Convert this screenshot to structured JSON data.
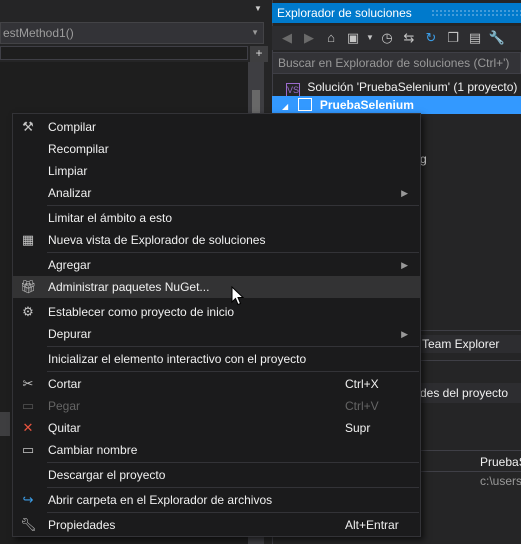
{
  "editor": {
    "method_dropdown": "estMethod1()",
    "split_button": "+"
  },
  "solution_explorer": {
    "title": "Explorador de soluciones",
    "search_placeholder": "Buscar en Explorador de soluciones (Ctrl+')",
    "solution_label": "Solución 'PruebaSelenium' (1 proyecto)",
    "project_label": "PruebaSelenium",
    "fragment_g": "g",
    "team_explorer_tab": "Team Explorer",
    "properties_title": "des del proyecto",
    "prop_value_1": "PruebaS",
    "prop_value_2": "c:\\users"
  },
  "context_menu": {
    "compilar": "Compilar",
    "recompilar": "Recompilar",
    "limpiar": "Limpiar",
    "analizar": "Analizar",
    "limitar": "Limitar el ámbito a esto",
    "nueva_vista": "Nueva vista de Explorador de soluciones",
    "agregar": "Agregar",
    "nuget": "Administrar paquetes NuGet...",
    "establecer": "Establecer como proyecto de inicio",
    "depurar": "Depurar",
    "inicializar": "Inicializar el elemento interactivo con el proyecto",
    "cortar": "Cortar",
    "cortar_sc": "Ctrl+X",
    "pegar": "Pegar",
    "pegar_sc": "Ctrl+V",
    "quitar": "Quitar",
    "quitar_sc": "Supr",
    "cambiar_nombre": "Cambiar nombre",
    "descargar": "Descargar el proyecto",
    "abrir_carpeta": "Abrir carpeta en el Explorador de archivos",
    "propiedades": "Propiedades",
    "propiedades_sc": "Alt+Entrar"
  },
  "colors": {
    "accent": "#007acc",
    "selection": "#3399ff",
    "menu_bg": "#1b1b1c",
    "quitar_icon": "#e8543f",
    "folder_icon": "#3c9ee8"
  }
}
